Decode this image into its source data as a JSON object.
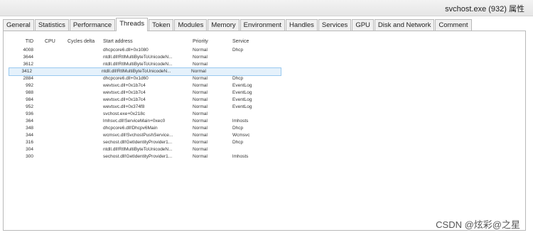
{
  "window": {
    "title": "svchost.exe (932) 属性"
  },
  "tabs": [
    {
      "label": "General",
      "active": false
    },
    {
      "label": "Statistics",
      "active": false
    },
    {
      "label": "Performance",
      "active": false
    },
    {
      "label": "Threads",
      "active": true
    },
    {
      "label": "Token",
      "active": false
    },
    {
      "label": "Modules",
      "active": false
    },
    {
      "label": "Memory",
      "active": false
    },
    {
      "label": "Environment",
      "active": false
    },
    {
      "label": "Handles",
      "active": false
    },
    {
      "label": "Services",
      "active": false
    },
    {
      "label": "GPU",
      "active": false
    },
    {
      "label": "Disk and Network",
      "active": false
    },
    {
      "label": "Comment",
      "active": false
    }
  ],
  "threads": {
    "columns": {
      "tid": "TID",
      "cpu": "CPU",
      "cycles": "Cycles delta",
      "address": "Start address",
      "priority": "Priority",
      "service": "Service"
    },
    "rows": [
      {
        "tid": "4008",
        "address": "dhcpcore6.dll+0x1080",
        "priority": "Normal",
        "service": "Dhcp"
      },
      {
        "tid": "3644",
        "address": "ntdll.dll!RtlMultiByteToUnicodeN...",
        "priority": "Normal",
        "service": ""
      },
      {
        "tid": "3612",
        "address": "ntdll.dll!RtlMultiByteToUnicodeN...",
        "priority": "Normal",
        "service": ""
      },
      {
        "tid": "3412",
        "address": "ntdll.dll!RtlMultiByteToUnicodeN...",
        "priority": "Normal",
        "service": "",
        "selected": true
      },
      {
        "tid": "2884",
        "address": "dhcpcore6.dll+0x1d60",
        "priority": "Normal",
        "service": "Dhcp"
      },
      {
        "tid": "992",
        "address": "wevtsvc.dll+0x1b7c4",
        "priority": "Normal",
        "service": "EventLog"
      },
      {
        "tid": "988",
        "address": "wevtsvc.dll+0x1b7c4",
        "priority": "Normal",
        "service": "EventLog"
      },
      {
        "tid": "984",
        "address": "wevtsvc.dll+0x1b7c4",
        "priority": "Normal",
        "service": "EventLog"
      },
      {
        "tid": "952",
        "address": "wevtsvc.dll+0x374f8",
        "priority": "Normal",
        "service": "EventLog"
      },
      {
        "tid": "936",
        "address": "svchost.exe+0x218c",
        "priority": "Normal",
        "service": ""
      },
      {
        "tid": "364",
        "address": "lmhsvc.dll!ServiceMain+0xec0",
        "priority": "Normal",
        "service": "lmhosts"
      },
      {
        "tid": "348",
        "address": "dhcpcore6.dll!Dhcpv6Main",
        "priority": "Normal",
        "service": "Dhcp"
      },
      {
        "tid": "344",
        "address": "wcmsvc.dll!SvchostPushService...",
        "priority": "Normal",
        "service": "Wcmsvc"
      },
      {
        "tid": "316",
        "address": "sechost.dll!GetIdentityProvider1...",
        "priority": "Normal",
        "service": "Dhcp"
      },
      {
        "tid": "304",
        "address": "ntdll.dll!RtlMultiByteToUnicodeN...",
        "priority": "Normal",
        "service": ""
      },
      {
        "tid": "300",
        "address": "sechost.dll!GetIdentityProvider1...",
        "priority": "Normal",
        "service": "lmhosts"
      }
    ]
  },
  "watermark": "CSDN @炫彩@之星"
}
